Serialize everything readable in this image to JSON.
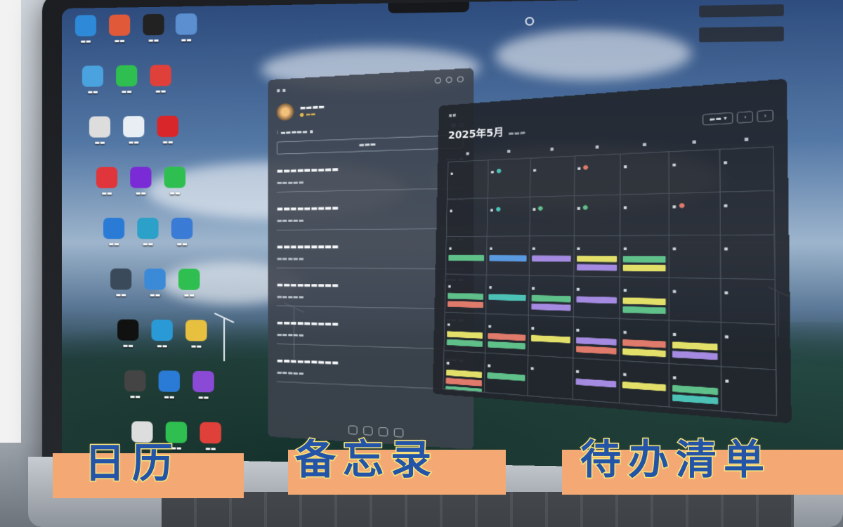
{
  "banner": {
    "calendar": "日历",
    "memo": "备忘录",
    "todo": "待办清单"
  },
  "desktop_icons": [
    {
      "icon": "computer-icon",
      "color": "#2e8ad8"
    },
    {
      "icon": "app-grid-icon",
      "color": "#e05a3a"
    },
    {
      "icon": "qq-penguin-icon",
      "color": "#222222"
    },
    {
      "icon": "folder-icon",
      "color": "#5b8fd0"
    },
    {
      "icon": "recycle-bin-icon",
      "color": "#4aa3df"
    },
    {
      "icon": "wechat-icon",
      "color": "#2fbf50"
    },
    {
      "icon": "cloud-icon",
      "color": "#e0403a"
    },
    {
      "icon": "document-icon",
      "color": "#dddddd"
    },
    {
      "icon": "file-icon",
      "color": "#e8eef4"
    },
    {
      "icon": "wps-icon",
      "color": "#d8262b"
    },
    {
      "icon": "music-icon",
      "color": "#e0353a"
    },
    {
      "icon": "video-icon",
      "color": "#7a2bd6"
    },
    {
      "icon": "phone-icon",
      "color": "#2fbf50"
    },
    {
      "icon": "browser-icon",
      "color": "#2a7bd6"
    },
    {
      "icon": "monitor-icon",
      "color": "#2ba0c8"
    },
    {
      "icon": "search-icon",
      "color": "#3a7bd6"
    },
    {
      "icon": "tools-icon",
      "color": "#3a4a5a"
    },
    {
      "icon": "chat-icon",
      "color": "#3a8ad8"
    },
    {
      "icon": "map-icon",
      "color": "#2fbf50"
    },
    {
      "icon": "capcut-icon",
      "color": "#111111"
    },
    {
      "icon": "edge-icon",
      "color": "#2a9ad6"
    },
    {
      "icon": "folder-yellow-icon",
      "color": "#e8c040"
    },
    {
      "icon": "image-icon",
      "color": "#444444"
    },
    {
      "icon": "store-icon",
      "color": "#2a7bd6"
    },
    {
      "icon": "triangle-icon",
      "color": "#8a4ad6"
    },
    {
      "icon": "gallery-icon",
      "color": "#dddddd"
    },
    {
      "icon": "android-icon",
      "color": "#2fbf50"
    },
    {
      "icon": "chrome-icon",
      "color": "#e0403a"
    },
    {
      "icon": "notes-icon",
      "color": "#e8a040"
    }
  ],
  "memo": {
    "items_count": 6
  },
  "calendar": {
    "title": "2025年5月",
    "rows": 6,
    "cols": 7,
    "event_colors": {
      "green": "#5fc08a",
      "yellow": "#e3e06a",
      "purple": "#a48ae0",
      "red": "#e07a6a",
      "teal": "#4cc2b6",
      "blue": "#5a9ae0"
    }
  }
}
